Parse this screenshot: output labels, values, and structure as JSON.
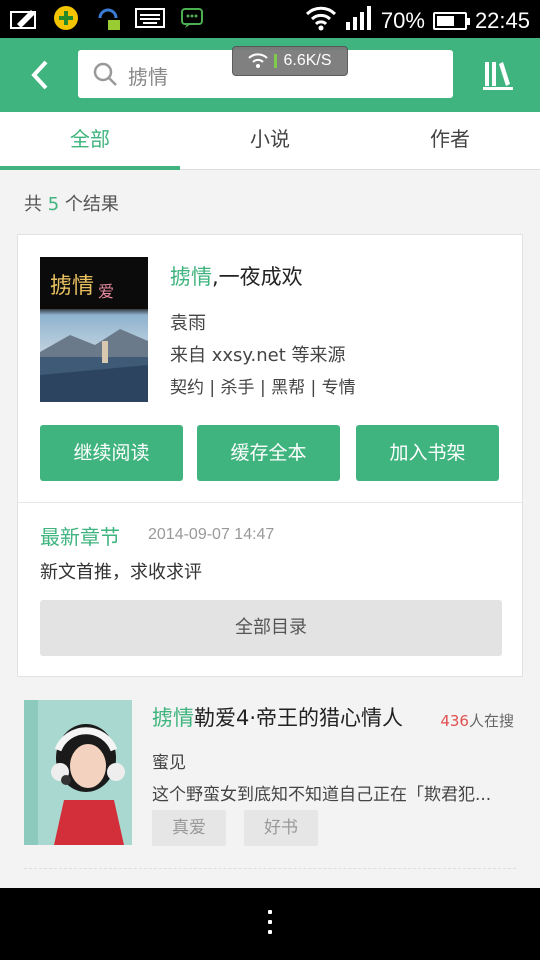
{
  "status_bar": {
    "wifi_icon": "wifi-icon",
    "signal_icon": "signal-icon",
    "battery_percent": "70%",
    "battery_level": 0.7,
    "time": "22:45"
  },
  "toolbar": {
    "search_query": "掳情",
    "net_speed": "6.6K/S"
  },
  "tabs": [
    {
      "label": "全部",
      "active": true
    },
    {
      "label": "小说",
      "active": false
    },
    {
      "label": "作者",
      "active": false
    }
  ],
  "results": {
    "prefix": "共",
    "count": "5",
    "suffix": "个结果"
  },
  "main_book": {
    "title_highlight": "掳情",
    "title_rest": ",一夜成欢",
    "author": "袁雨",
    "source": "来自 xxsy.net 等来源",
    "tags": "契约 | 杀手 | 黑帮 | 专情",
    "buttons": {
      "continue": "继续阅读",
      "cache": "缓存全本",
      "add_shelf": "加入书架"
    },
    "latest_label": "最新章节",
    "latest_time": "2014-09-07 14:47",
    "latest_chapter": "新文首推，求收求评",
    "toc_button": "全部目录"
  },
  "second_book": {
    "title_highlight": "掳情",
    "title_rest": "勒爱4·帝王的猎心情人",
    "hot_count": "436",
    "hot_suffix": "人在搜",
    "author": "蜜见",
    "description": "这个野蛮女到底知不知道自己正在「欺君犯...",
    "tags": [
      "真爱",
      "好书"
    ]
  },
  "colors": {
    "accent": "#40b47e",
    "hot": "#e05050"
  }
}
